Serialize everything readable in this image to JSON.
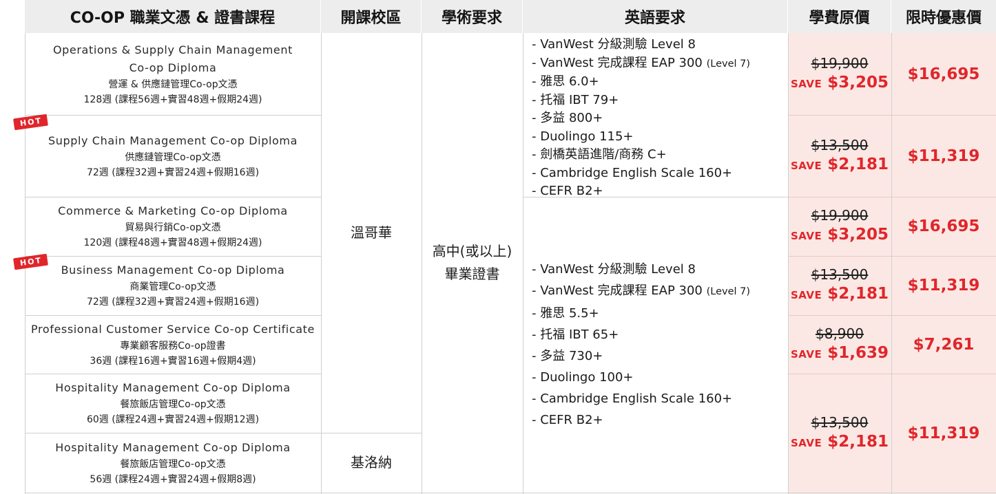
{
  "header": {
    "program": "CO-OP 職業文憑 & 證書課程",
    "campus": "開課校區",
    "academic": "學術要求",
    "english": "英語要求",
    "original_price": "學費原價",
    "sale_price": "限時優惠價"
  },
  "badge": "HOT",
  "programs": [
    {
      "name_en": "Operations & Supply Chain Management",
      "name_en2": "Co-op Diploma",
      "name_zh": "營運 & 供應鏈管理Co-op文憑",
      "duration": "128週 (課程56週+實習48週+假期24週)",
      "original": "$19,900",
      "save_label": "SAVE",
      "save": "$3,205",
      "sale": "$16,695"
    },
    {
      "name_en": "Supply Chain Management Co-op Diploma",
      "name_zh": "供應鏈管理Co-op文憑",
      "duration": "72週 (課程32週+實習24週+假期16週)",
      "original": "$13,500",
      "save_label": "SAVE",
      "save": "$2,181",
      "sale": "$11,319"
    },
    {
      "name_en": "Commerce & Marketing Co-op Diploma",
      "name_zh": "貿易與行銷Co-op文憑",
      "duration": "120週 (課程48週+實習48週+假期24週)",
      "original": "$19,900",
      "save_label": "SAVE",
      "save": "$3,205",
      "sale": "$16,695"
    },
    {
      "name_en": "Business Management Co-op Diploma",
      "name_zh": "商業管理Co-op文憑",
      "duration": "72週 (課程32週+實習24週+假期16週)",
      "original": "$13,500",
      "save_label": "SAVE",
      "save": "$2,181",
      "sale": "$11,319"
    },
    {
      "name_en": "Professional Customer Service Co-op Certificate",
      "name_zh": "專業顧客服務Co-op證書",
      "duration": "36週 (課程16週+實習16週+假期4週)",
      "original": "$8,900",
      "save_label": "SAVE",
      "save": "$1,639",
      "sale": "$7,261"
    },
    {
      "name_en": "Hospitality Management Co-op Diploma",
      "name_zh": "餐旅飯店管理Co-op文憑",
      "duration": "60週 (課程24週+實習24週+假期12週)",
      "original": "$13,500",
      "save_label": "SAVE",
      "save": "$2,181",
      "sale": "$11,319"
    },
    {
      "name_en": "Hospitality Management Co-op Diploma",
      "name_zh": "餐旅飯店管理Co-op文憑",
      "duration": "56週 (課程24週+實習24週+假期8週)"
    }
  ],
  "campuses": {
    "vancouver": "溫哥華",
    "kelowna": "基洛納"
  },
  "academic_req": {
    "line1": "高中(或以上)",
    "line2": "畢業證書"
  },
  "english_req_a": [
    "- VanWest 分級測驗 Level 8",
    "- VanWest 完成課程 EAP 300",
    "(Level 7)",
    "- 雅思 6.0+",
    "- 托福 IBT 79+",
    "- 多益 800+",
    "- Duolingo 115+",
    "- 劍橋英語進階/商務 C+",
    "- Cambridge English Scale 160+",
    "- CEFR B2+"
  ],
  "english_req_b": [
    "- VanWest 分級測驗 Level 8",
    "- VanWest 完成課程 EAP 300",
    "(Level 7)",
    "- 雅思 5.5+",
    "- 托福 IBT 65+",
    "- 多益 730+",
    "- Duolingo 100+",
    "- Cambridge English Scale 160+",
    "- CEFR B2+"
  ],
  "colors": {
    "accent_red": "#e0262b",
    "price_bg": "#fbe8e4",
    "header_bg": "#ededed"
  }
}
